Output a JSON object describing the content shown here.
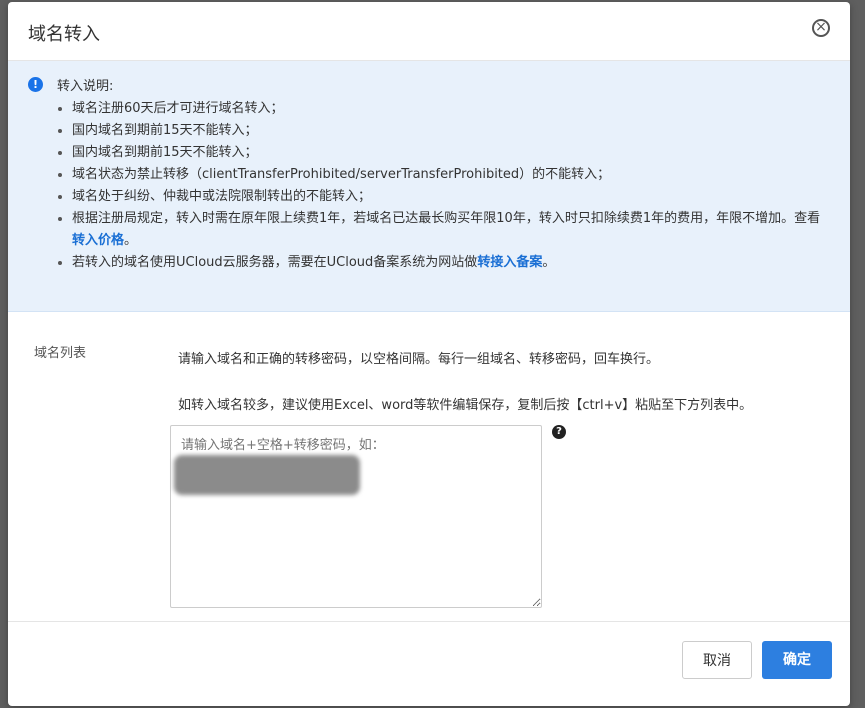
{
  "dialog": {
    "title": "域名转入",
    "close_symbol": "×"
  },
  "notice": {
    "heading": "转入说明:",
    "items": [
      "域名注册60天后才可进行域名转入；",
      "国内域名到期前15天不能转入；",
      "国内域名到期前15天不能转入；",
      "域名状态为禁止转移（clientTransferProhibited/serverTransferProhibited）的不能转入；",
      "域名处于纠纷、仲裁中或法院限制转出的不能转入；"
    ],
    "item6_text": "根据注册局规定，转入时需在原年限上续费1年，若域名已达最长购买年限10年，转入时只扣除续费1年的费用，年限不增加。查看",
    "item6_link": "转入价格",
    "item6_suffix": "。",
    "item7_text": "若转入的域名使用UCloud云服务器，需要在UCloud备案系统为网站做",
    "item7_link": "转接入备案",
    "item7_suffix": "。"
  },
  "form": {
    "label": "域名列表",
    "hint1": "请输入域名和正确的转移密码，以空格间隔。每行一组域名、转移密码，回车换行。",
    "hint2": "如转入域名较多，建议使用Excel、word等软件编辑保存，复制后按【ctrl+v】粘贴至下方列表中。",
    "placeholder": "请输入域名+空格+转移密码，如：",
    "help_symbol": "?"
  },
  "footer": {
    "cancel_label": "取消",
    "ok_label": "确定"
  }
}
